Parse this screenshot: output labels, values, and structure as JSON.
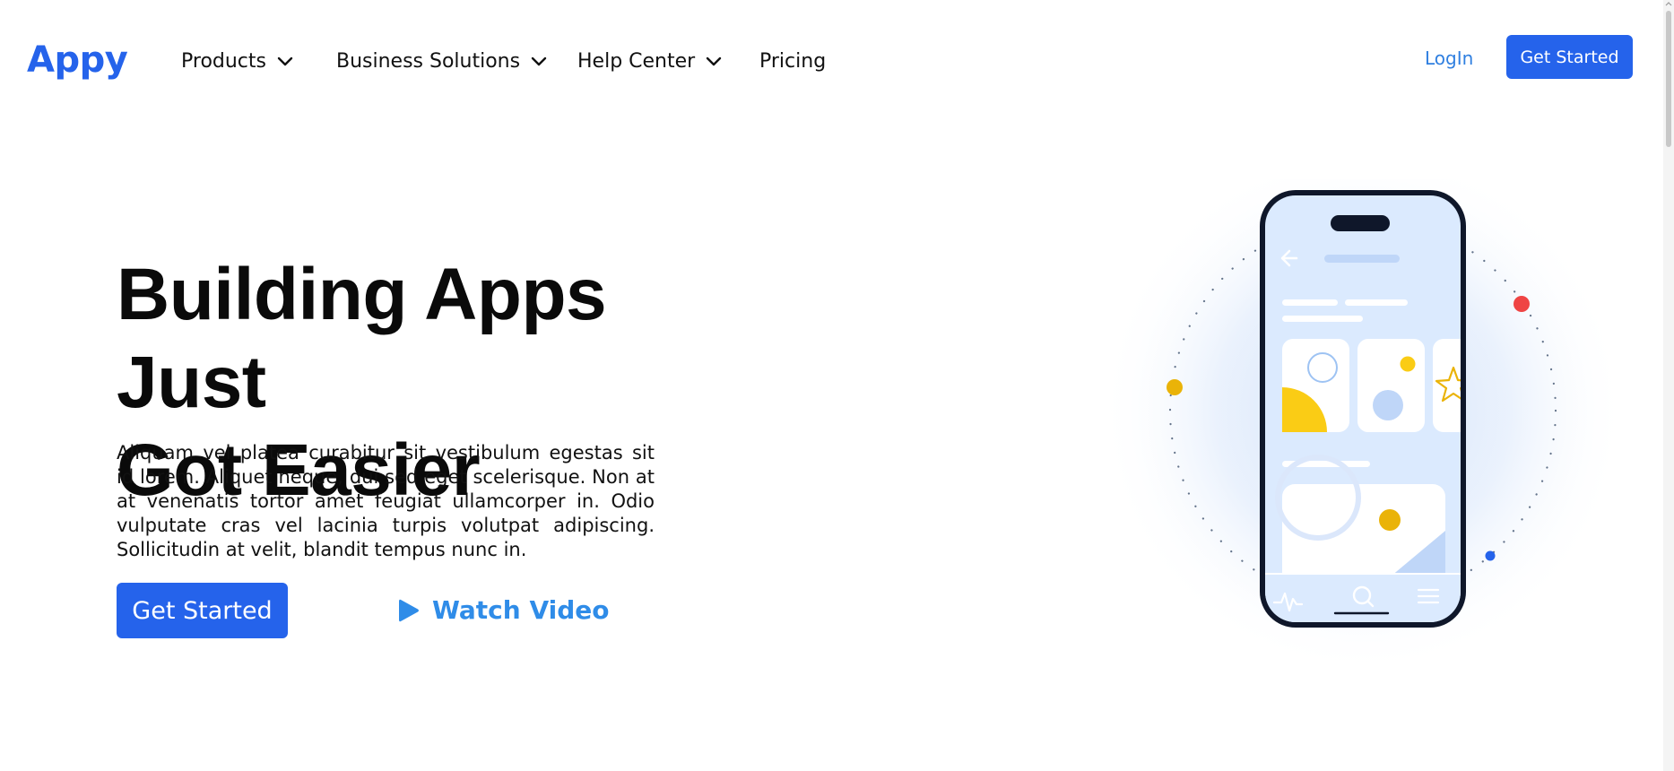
{
  "brand": {
    "name": "Appy",
    "color": "#2563eb"
  },
  "nav": {
    "items": [
      {
        "label": "Products",
        "has_dropdown": true
      },
      {
        "label": "Business Solutions",
        "has_dropdown": true
      },
      {
        "label": "Help Center",
        "has_dropdown": true
      },
      {
        "label": "Pricing",
        "has_dropdown": false
      }
    ],
    "login_label": "LogIn",
    "cta_label": "Get Started"
  },
  "hero": {
    "title_line1": "Building Apps Just",
    "title_line2": "Got Easier",
    "description": "Aliquam vel platea curabitur sit vestibulum egestas sit id lorem. Aliquet neque, dui sed eget scelerisque. Non at at venenatis tortor amet feugiat ullamcorper in. Odio vulputate cras vel lacinia turpis volutpat adipiscing. Sollicitudin at velit, blandit tempus nunc in.",
    "cta_label": "Get Started",
    "video_label": "Watch Video"
  },
  "illustration": {
    "icons": [
      "back-arrow-icon",
      "pulse-icon",
      "search-icon",
      "menu-icon",
      "star-icon"
    ],
    "colors": {
      "phone_frame": "#0f172a",
      "screen": "#dbeafe",
      "yellow": "#facc15",
      "red": "#ef4444",
      "blue": "#2563eb"
    }
  }
}
